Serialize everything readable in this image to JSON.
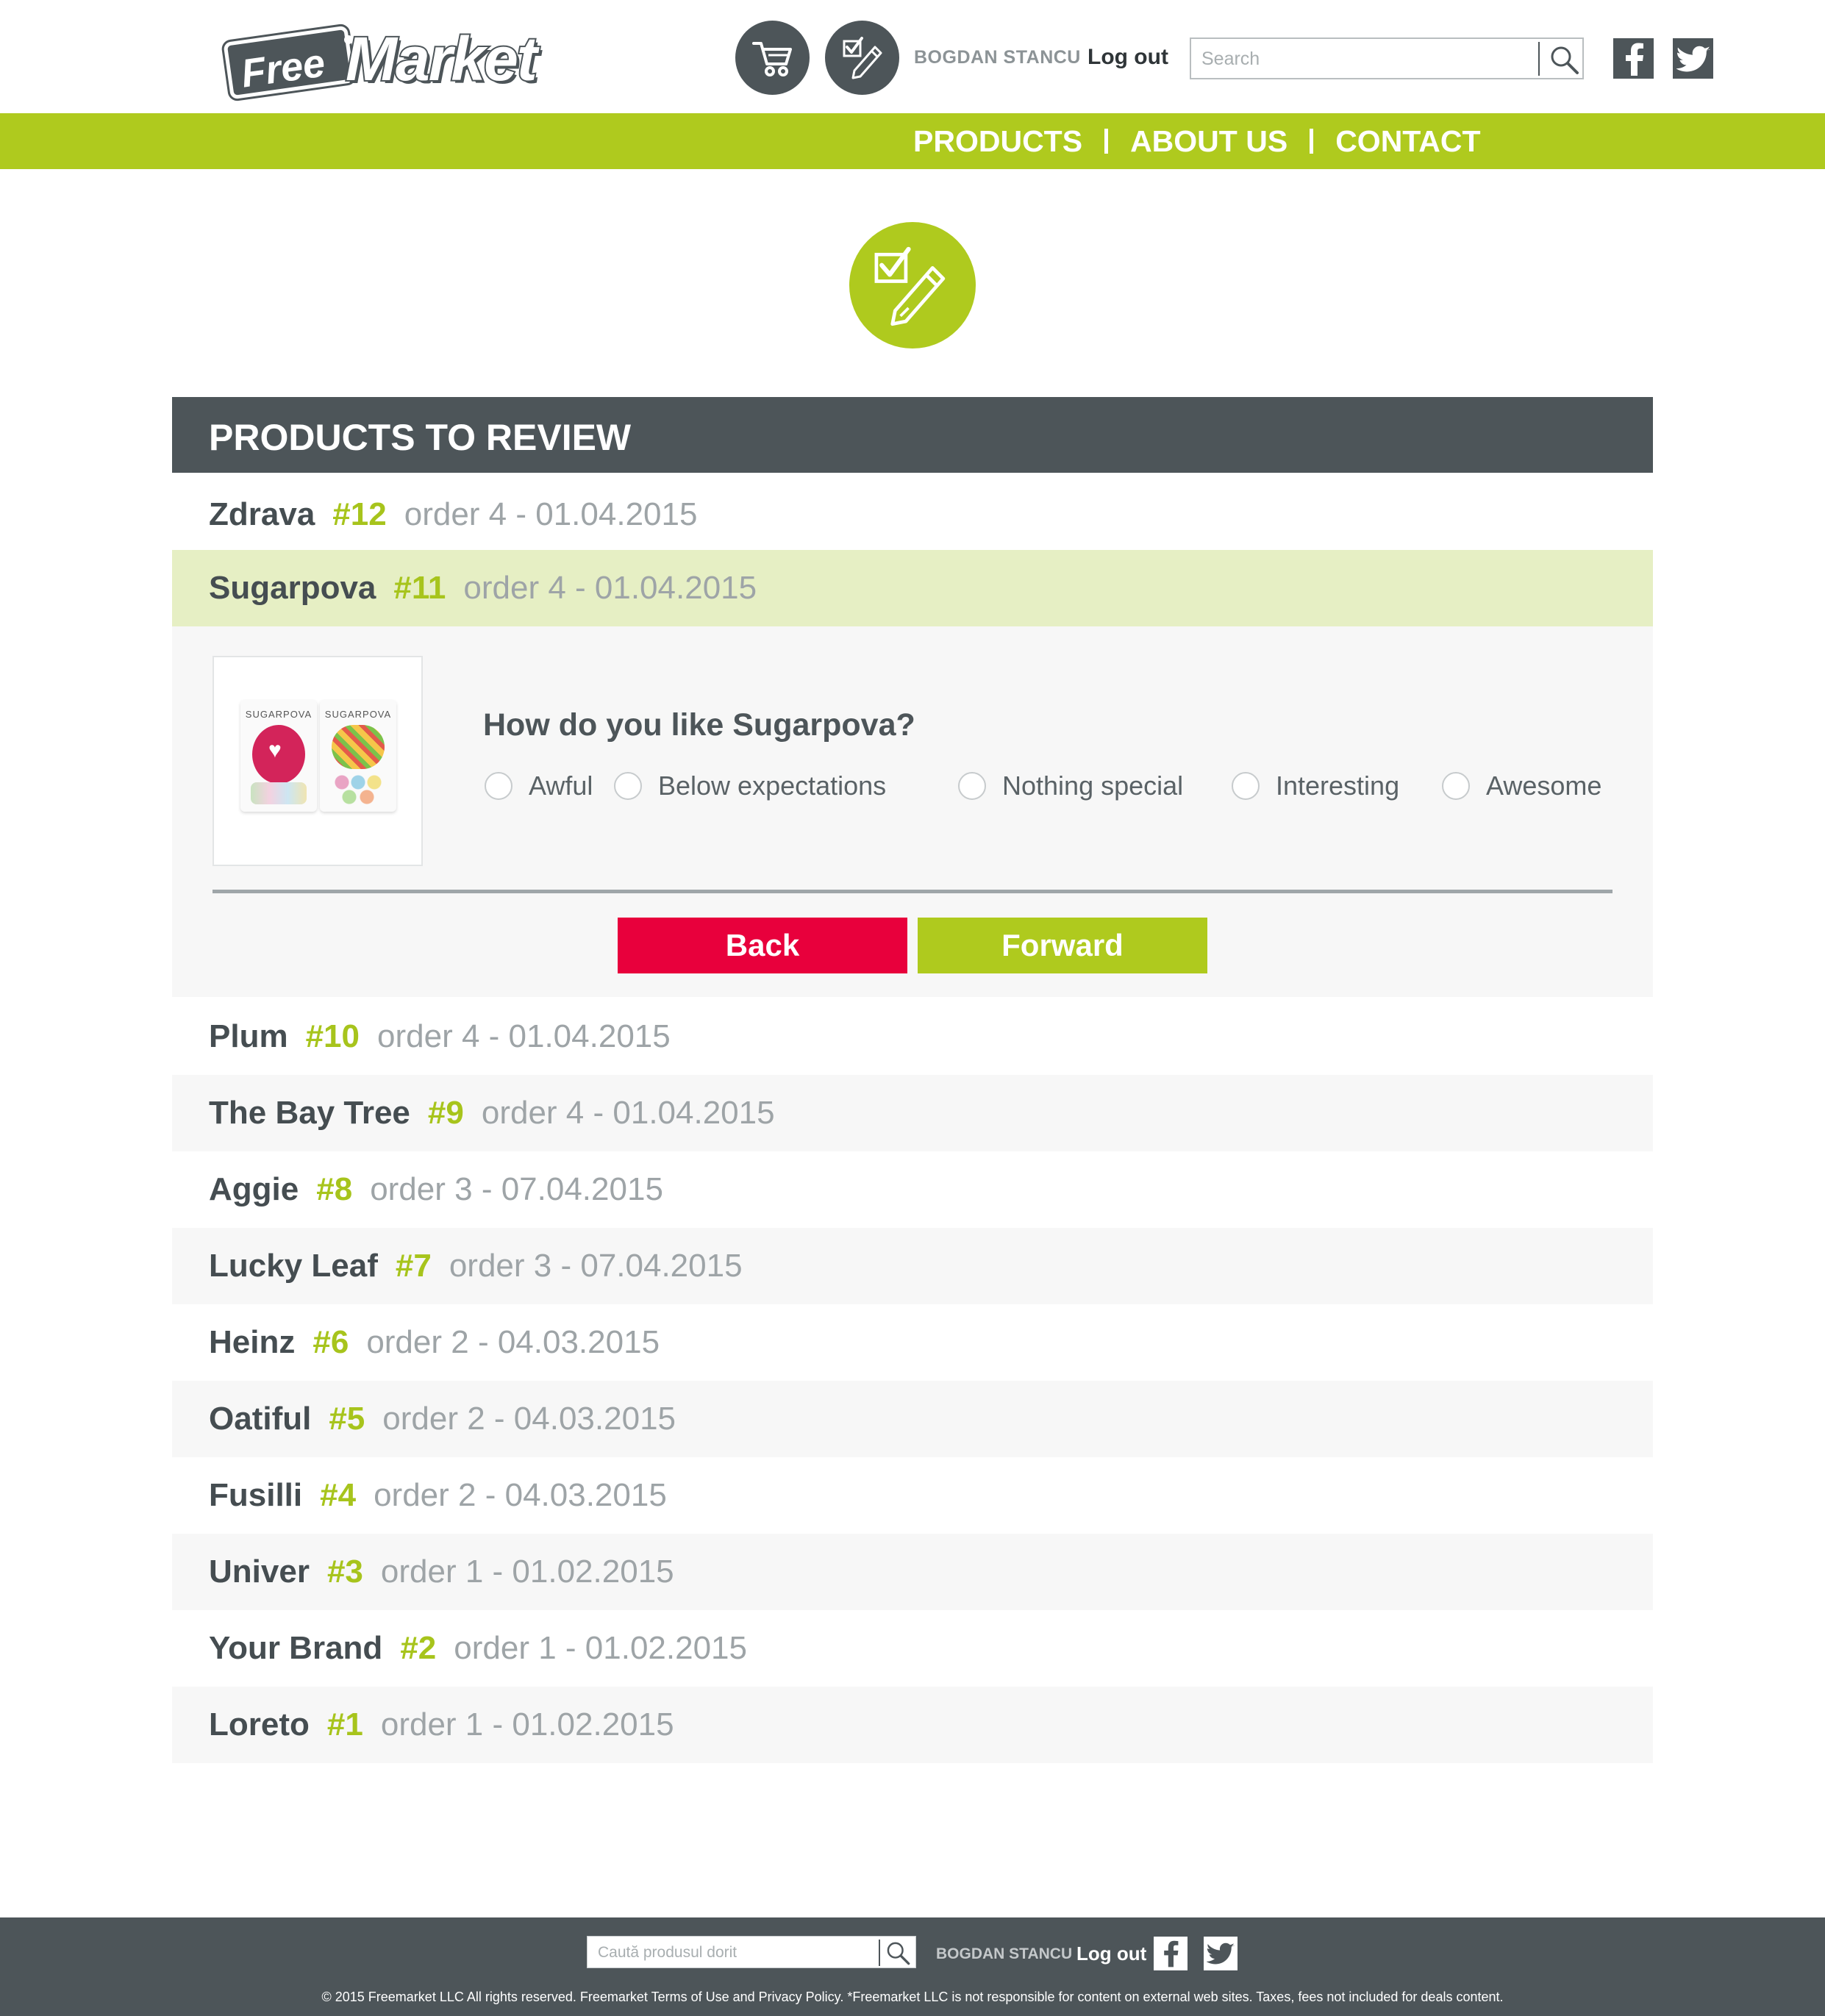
{
  "header": {
    "logo_tag": "Free",
    "logo_word": "Market",
    "user_name": "BOGDAN STANCU",
    "logout_label": "Log out",
    "search_placeholder": "Search",
    "icons": [
      "cart-icon",
      "review-icon",
      "search-icon",
      "facebook-icon",
      "twitter-icon"
    ]
  },
  "nav": {
    "items": [
      "PRODUCTS",
      "ABOUT US",
      "CONTACT"
    ]
  },
  "panel": {
    "title": "PRODUCTS TO REVIEW",
    "rows": [
      {
        "name": "Zdrava",
        "number": "#12",
        "order": "order 4 - 01.04.2015"
      },
      {
        "name": "Sugarpova",
        "number": "#11",
        "order": "order 4 - 01.04.2015"
      },
      {
        "name": "Plum",
        "number": "#10",
        "order": "order 4 - 01.04.2015"
      },
      {
        "name": "The Bay Tree",
        "number": "#9",
        "order": "order 4 - 01.04.2015"
      },
      {
        "name": "Aggie",
        "number": "#8",
        "order": "order 3 - 07.04.2015"
      },
      {
        "name": "Lucky Leaf",
        "number": "#7",
        "order": "order 3 - 07.04.2015"
      },
      {
        "name": "Heinz",
        "number": "#6",
        "order": "order 2 - 04.03.2015"
      },
      {
        "name": "Oatiful",
        "number": "#5",
        "order": "order 2 - 04.03.2015"
      },
      {
        "name": "Fusilli",
        "number": "#4",
        "order": "order 2 - 04.03.2015"
      },
      {
        "name": "Univer",
        "number": "#3",
        "order": "order 1 - 01.02.2015"
      },
      {
        "name": "Your Brand",
        "number": "#2",
        "order": "order 1 - 01.02.2015"
      },
      {
        "name": "Loreto",
        "number": "#1",
        "order": "order 1 - 01.02.2015"
      }
    ],
    "review": {
      "product_brand": "SUGARPOVA",
      "question": "How do you like Sugarpova?",
      "options": [
        "Awful",
        "Below expectations",
        "Nothing special",
        "Interesting",
        "Awesome"
      ],
      "back_label": "Back",
      "forward_label": "Forward"
    }
  },
  "footer": {
    "search_placeholder": "Caută produsul dorit",
    "user_name": "BOGDAN STANCU",
    "logout_label": "Log out",
    "copyright": "© 2015 Freemarket LLC All rights reserved. Freemarket Terms of Use and Privacy Policy. *Freemarket LLC is not responsible for content on external web sites. Taxes, fees not included for deals content."
  },
  "colors": {
    "accent_green": "#afca1e",
    "dark_gray": "#4d5559",
    "back_red": "#e8003c",
    "active_row": "#e6efc4"
  }
}
